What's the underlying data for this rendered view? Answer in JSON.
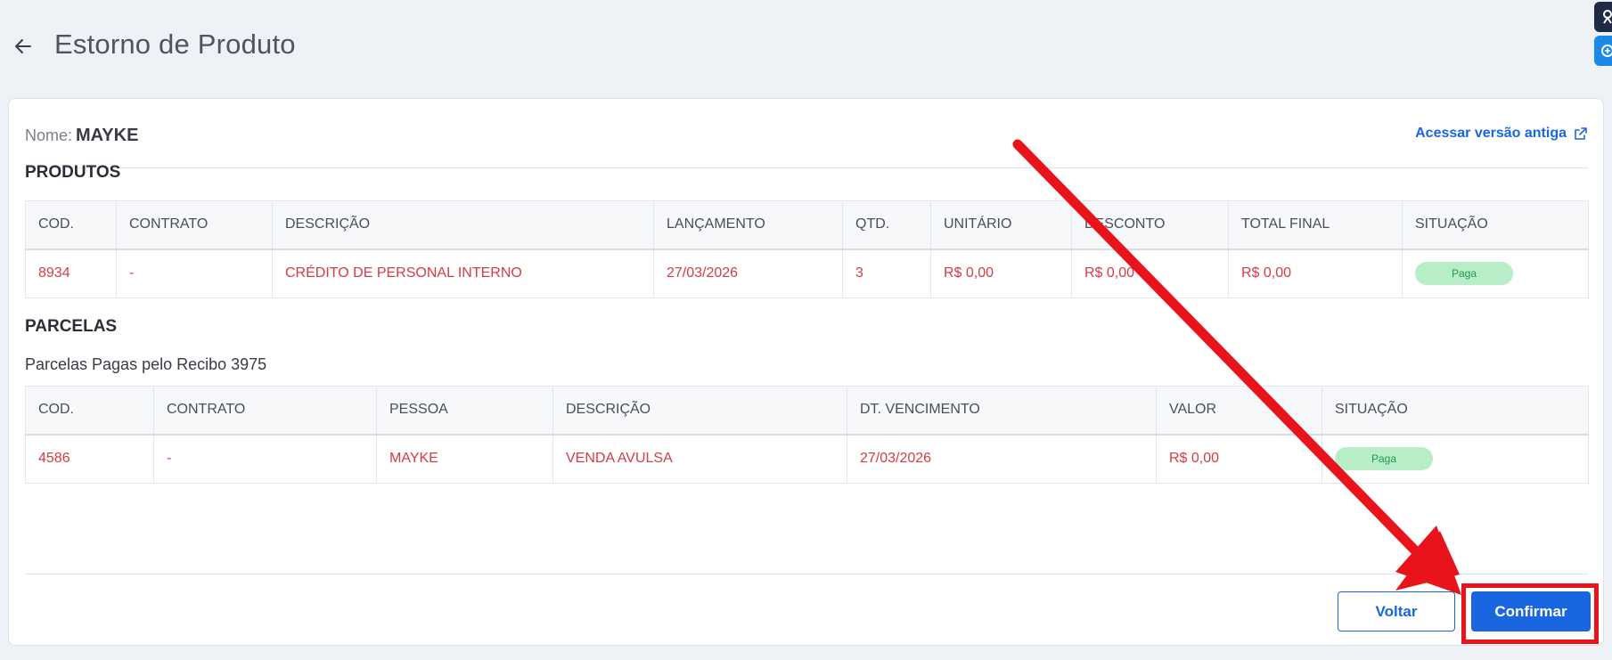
{
  "header": {
    "title": "Estorno de Produto"
  },
  "customer": {
    "name_label": "Nome:",
    "name_value": "MAYKE",
    "old_version_link": "Acessar versão antiga"
  },
  "produtos": {
    "section_title": "PRODUTOS",
    "columns": [
      "COD.",
      "CONTRATO",
      "DESCRIÇÃO",
      "LANÇAMENTO",
      "QTD.",
      "UNITÁRIO",
      "DESCONTO",
      "TOTAL FINAL",
      "SITUAÇÃO"
    ],
    "rows": [
      {
        "cod": "8934",
        "contrato": "-",
        "descricao": "CRÉDITO DE PERSONAL INTERNO",
        "lancamento": "27/03/2026",
        "qtd": "3",
        "unitario": "R$ 0,00",
        "desconto": "R$ 0,00",
        "total_final": "R$ 0,00",
        "situacao": "Paga"
      }
    ]
  },
  "parcelas": {
    "section_title": "PARCELAS",
    "subtitle": "Parcelas Pagas pelo Recibo 3975",
    "columns": [
      "COD.",
      "CONTRATO",
      "PESSOA",
      "DESCRIÇÃO",
      "DT. VENCIMENTO",
      "VALOR",
      "SITUAÇÃO"
    ],
    "rows": [
      {
        "cod": "4586",
        "contrato": "-",
        "pessoa": "MAYKE",
        "descricao": "VENDA AVULSA",
        "dt_vencimento": "27/03/2026",
        "valor": "R$ 0,00",
        "situacao": "Paga"
      }
    ]
  },
  "actions": {
    "back_label": "Voltar",
    "confirm_label": "Confirmar"
  },
  "colors": {
    "accent": "#1a66e0",
    "danger_text": "#d53b44",
    "badge_bg": "#b7eec8",
    "annotation": "#e8131b"
  },
  "icons": {
    "back": "arrow-left-icon",
    "external": "external-link-icon"
  }
}
